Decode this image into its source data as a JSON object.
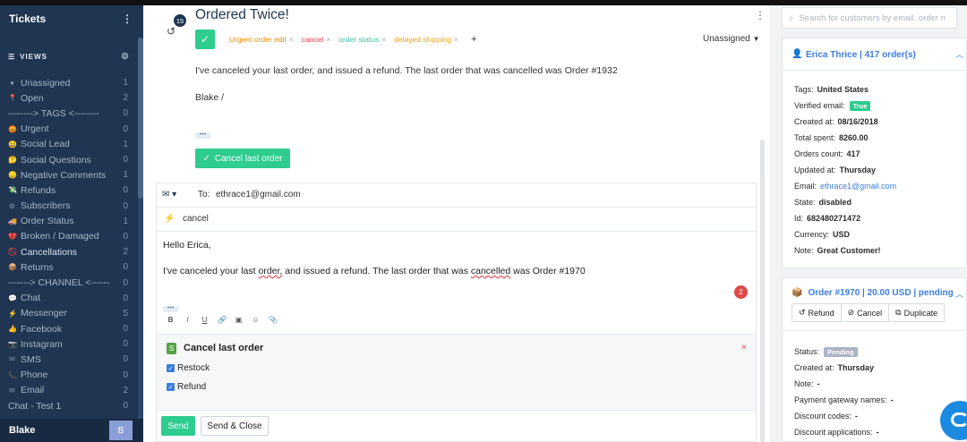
{
  "sidebar": {
    "title": "Tickets",
    "views_label": "VIEWS",
    "items": [
      {
        "icon": "circle-icon",
        "label": "Unassigned",
        "count": "1"
      },
      {
        "icon": "pin-icon",
        "label": "Open",
        "count": "2"
      },
      {
        "icon": "",
        "label": "--------> TAGS <--------",
        "count": "0"
      },
      {
        "icon": "emoji-angry-icon",
        "label": "Urgent",
        "count": "0"
      },
      {
        "icon": "emoji-icon",
        "label": "Social Lead",
        "count": "1"
      },
      {
        "icon": "emoji-icon",
        "label": "Social Questions",
        "count": "0"
      },
      {
        "icon": "emoji-icon",
        "label": "Negative Comments",
        "count": "1"
      },
      {
        "icon": "money-icon",
        "label": "Refunds",
        "count": "0"
      },
      {
        "icon": "gear-icon",
        "label": "Subscribers",
        "count": "0"
      },
      {
        "icon": "truck-icon",
        "label": "Order Status",
        "count": "1"
      },
      {
        "icon": "broken-heart-icon",
        "label": "Broken / Damaged",
        "count": "0"
      },
      {
        "icon": "cancel-icon",
        "label": "Cancellations",
        "count": "2"
      },
      {
        "icon": "box-icon",
        "label": "Returns",
        "count": "0"
      },
      {
        "icon": "",
        "label": "-------> CHANNEL <------",
        "count": "0"
      },
      {
        "icon": "chat-icon",
        "label": "Chat",
        "count": "0"
      },
      {
        "icon": "bolt-icon",
        "label": "Messenger",
        "count": "5"
      },
      {
        "icon": "thumbs-up-icon",
        "label": "Facebook",
        "count": "0"
      },
      {
        "icon": "camera-icon",
        "label": "Instagram",
        "count": "0"
      },
      {
        "icon": "sms-icon",
        "label": "SMS",
        "count": "0"
      },
      {
        "icon": "phone-icon",
        "label": "Phone",
        "count": "0"
      },
      {
        "icon": "email-icon",
        "label": "Email",
        "count": "2"
      },
      {
        "icon": "",
        "label": "Chat - Test 1",
        "count": "0"
      }
    ],
    "user_name": "Blake",
    "user_initial": "B"
  },
  "ticket": {
    "history_count": "15",
    "title": "Ordered Twice!",
    "tags": [
      {
        "label": "Urgent order edit",
        "color": "#f08c00"
      },
      {
        "label": "cancel",
        "color": "#e0485a"
      },
      {
        "label": "order status",
        "color": "#3fc1a5"
      },
      {
        "label": "delayed shipping",
        "color": "#f5a000"
      }
    ],
    "add_tag": "+",
    "assignee": "Unassigned",
    "message_line1": "I've canceled your last order, and issued a refund. The last order that was cancelled was Order #1932",
    "message_line2": "Blake /",
    "more_dots": "•••",
    "action_button": "Cancel last order"
  },
  "composer": {
    "to_label": "To:",
    "to_value": "ethrace1@gmail.com",
    "subject": "cancel",
    "greeting": "Hello Erica,",
    "body_part1": "I've canceled your last ",
    "body_word1": "order,",
    "body_part2": " and issued a refund. The last order that was ",
    "body_word2": "cancelled",
    "body_part3": " was Order #1970",
    "error_count": "2",
    "more_dots": "•••",
    "format_tools": [
      "B",
      "I",
      "U",
      "🔗",
      "▣",
      "☺",
      "📎"
    ],
    "macro_title": "Cancel last order",
    "macro_close": "×",
    "macro_options": [
      "Restock",
      "Refund"
    ],
    "send_label": "Send",
    "send_close_label": "Send & Close"
  },
  "customer": {
    "search_placeholder": "Search for customers by email, order n",
    "header": "Erica Thrice | 417 order(s)",
    "fields": [
      {
        "label": "Tags:",
        "value": "United States"
      },
      {
        "label": "Verified email:",
        "value": "True"
      },
      {
        "label": "Created at:",
        "value": "08/16/2018"
      },
      {
        "label": "Total spent:",
        "value": "8260.00"
      },
      {
        "label": "Orders count:",
        "value": "417"
      },
      {
        "label": "Updated at:",
        "value": "Thursday"
      },
      {
        "label": "Email:",
        "value": "ethrace1@gmail.com"
      },
      {
        "label": "State:",
        "value": "disabled"
      },
      {
        "label": "Id:",
        "value": "682480271472"
      },
      {
        "label": "Currency:",
        "value": "USD"
      },
      {
        "label": "Note:",
        "value": "Great Customer!"
      }
    ]
  },
  "order": {
    "header": "Order #1970 | 20.00 USD | pending",
    "buttons": [
      "Refund",
      "Cancel",
      "Duplicate"
    ],
    "fields": [
      {
        "label": "Status:",
        "value": "Pending"
      },
      {
        "label": "Created at:",
        "value": "Thursday"
      },
      {
        "label": "Note:",
        "value": "-"
      },
      {
        "label": "Payment gateway names:",
        "value": "-"
      },
      {
        "label": "Discount codes:",
        "value": "-"
      },
      {
        "label": "Discount applications:",
        "value": "-"
      }
    ]
  },
  "colors": {
    "sidebar_bg": "#1f3552",
    "accent_green": "#2ecc8f",
    "link_blue": "#3b7ddd",
    "error_red": "#e04848",
    "pending_grey": "#a9b4c7"
  }
}
